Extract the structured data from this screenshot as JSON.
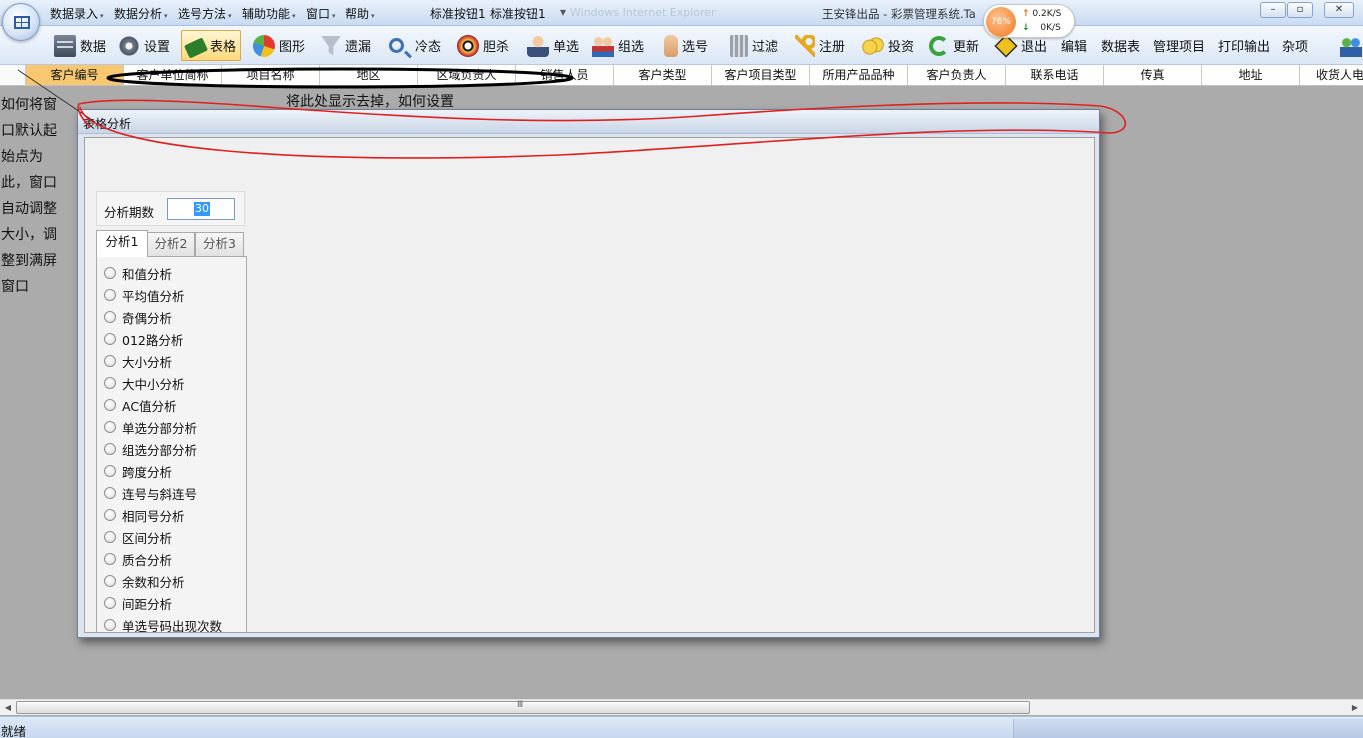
{
  "menu": {
    "items": [
      {
        "label": "数据录入",
        "caret": "▾"
      },
      {
        "label": "数据分析",
        "caret": "▾"
      },
      {
        "label": "选号方法",
        "caret": "▾"
      },
      {
        "label": "辅助功能",
        "caret": "▾"
      },
      {
        "label": "窗口",
        "caret": "▾"
      },
      {
        "label": "帮助",
        "caret": "▾"
      }
    ],
    "quick_buttons": [
      "标准按钮1",
      "标准按钮1"
    ],
    "faded_title": "Windows Internet Explorer",
    "title": "王安锋出品 - 彩票管理系统.Ta"
  },
  "net_widget": {
    "percent": "76%",
    "up": "0.2K/S",
    "down": "0K/S"
  },
  "toolbar": {
    "buttons": [
      {
        "label": "数据",
        "icon": "database-icon"
      },
      {
        "label": "设置",
        "icon": "gear-icon"
      },
      {
        "label": "表格",
        "icon": "table-icon",
        "active": true
      },
      {
        "label": "图形",
        "icon": "pie-chart-icon"
      },
      {
        "label": "遗漏",
        "icon": "funnel-icon"
      },
      {
        "label": "冷态",
        "icon": "search-icon"
      },
      {
        "label": "胆杀",
        "icon": "bagua-icon"
      },
      {
        "label": "单选",
        "icon": "person-icon"
      },
      {
        "label": "组选",
        "icon": "people-icon"
      },
      {
        "label": "选号",
        "icon": "hand-icon"
      },
      {
        "label": "过滤",
        "icon": "trash-icon"
      },
      {
        "label": "注册",
        "icon": "key-icon"
      },
      {
        "label": "投资",
        "icon": "coins-icon"
      },
      {
        "label": "更新",
        "icon": "refresh-icon"
      },
      {
        "label": "退出",
        "icon": "exit-icon"
      },
      {
        "label": "编辑",
        "icon": ""
      },
      {
        "label": "数据表",
        "icon": ""
      },
      {
        "label": "管理项目",
        "icon": ""
      },
      {
        "label": "打印输出",
        "icon": ""
      },
      {
        "label": "杂项",
        "icon": ""
      }
    ],
    "accent_color": "#ffd97a"
  },
  "columns": [
    "客户编号",
    "客户单位简称",
    "项目名称",
    "地区",
    "区域负责人",
    "销售人员",
    "客户类型",
    "客户项目类型",
    "所用产品品种",
    "客户负责人",
    "联系电话",
    "传真",
    "地址",
    "收货人电"
  ],
  "left_note": [
    "如何将窗",
    "口默认起",
    "始点为",
    "此，窗口",
    "自动调整",
    "大小，调",
    "整到满屏",
    "窗口"
  ],
  "annotation": {
    "text": "将此处显示去掉，如何设置",
    "color": "#e02020"
  },
  "child_window": {
    "title": "表格分析",
    "period_label": "分析期数",
    "period_value": "30",
    "tabs": [
      "分析1",
      "分析2",
      "分析3"
    ],
    "selected_tab": "分析1",
    "options": [
      "和值分析",
      "平均值分析",
      "奇偶分析",
      "012路分析",
      "大小分析",
      "大中小分析",
      "AC值分析",
      "单选分部分析",
      "组选分部分析",
      "跨度分析",
      "连号与斜连号",
      "相同号分析",
      "区间分析",
      "质合分析",
      "余数和分析",
      "间距分析",
      "单选号码出现次数"
    ]
  },
  "scrollbar": {
    "thumb_grip": "Ⅲ"
  },
  "status": {
    "text": "就绪"
  }
}
